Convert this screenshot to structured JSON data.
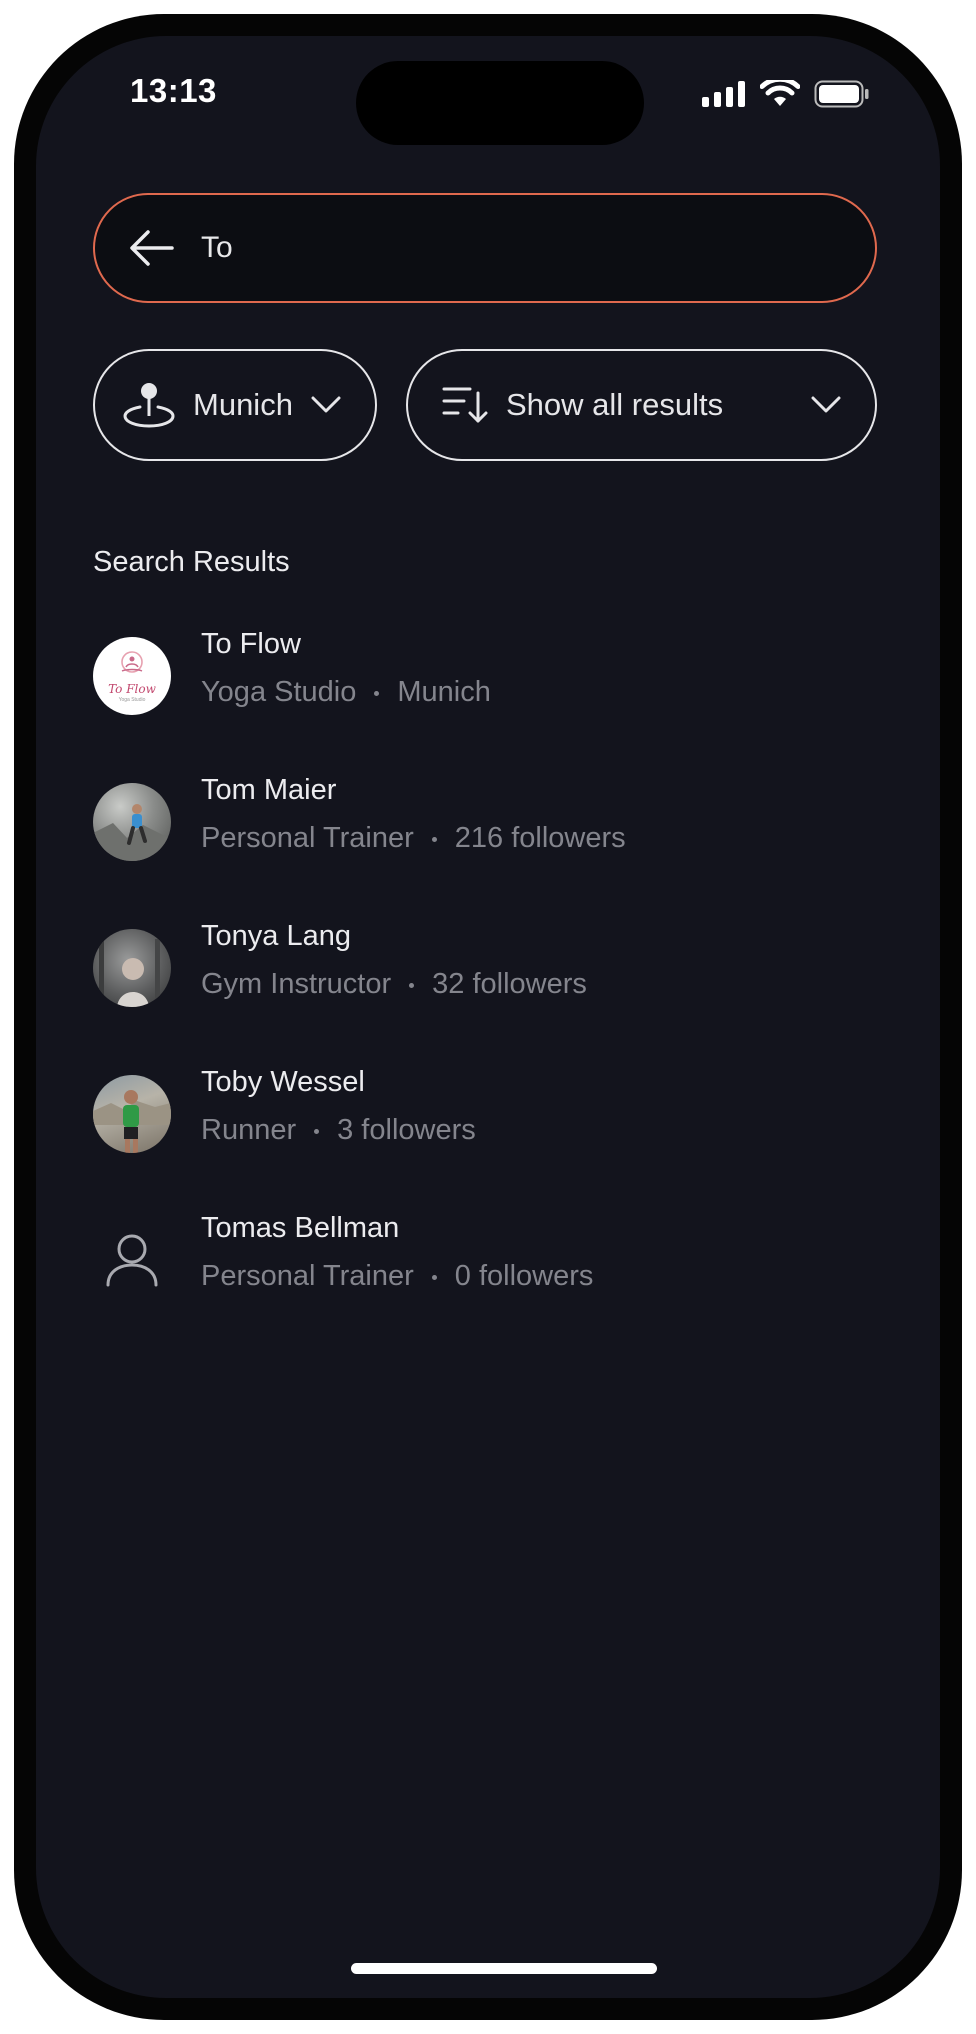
{
  "status_bar": {
    "time": "13:13"
  },
  "search": {
    "value": "To",
    "placeholder": ""
  },
  "filters": {
    "location_label": "Munich",
    "sort_label": "Show all results"
  },
  "section_title": "Search Results",
  "results": [
    {
      "name": "To Flow",
      "category": "Yoga Studio",
      "detail": "Munich",
      "avatar_text": "To Flow",
      "avatar_subtext": "Yoga Studio"
    },
    {
      "name": "Tom Maier",
      "category": "Personal Trainer",
      "detail": "216 followers"
    },
    {
      "name": "Tonya Lang",
      "category": "Gym Instructor",
      "detail": "32 followers"
    },
    {
      "name": "Toby Wessel",
      "category": "Runner",
      "detail": "3 followers"
    },
    {
      "name": "Tomas Bellman",
      "category": "Personal Trainer",
      "detail": "0 followers"
    }
  ],
  "colors": {
    "accent": "#e0694e",
    "background": "#13141d",
    "muted_text": "#84858d"
  }
}
